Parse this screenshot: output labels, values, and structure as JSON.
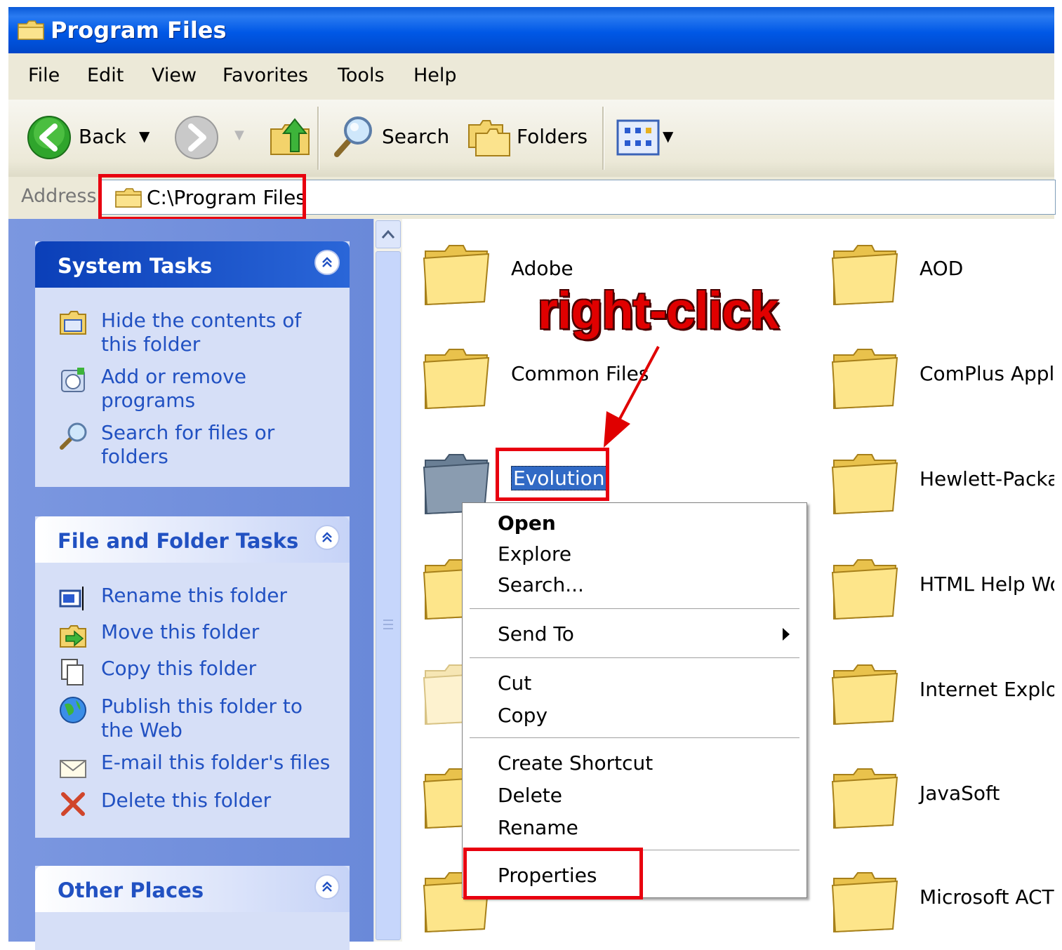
{
  "window": {
    "title": "Program Files",
    "title_icon": "folder-icon"
  },
  "menu": [
    "File",
    "Edit",
    "View",
    "Favorites",
    "Tools",
    "Help"
  ],
  "toolbar": {
    "back_label": "Back",
    "search_label": "Search",
    "folders_label": "Folders"
  },
  "address": {
    "label": "Address",
    "path": "C:\\Program Files"
  },
  "panels": {
    "system_tasks": {
      "title": "System Tasks",
      "links": [
        "Hide the contents of this folder",
        "Add or remove programs",
        "Search for files or folders"
      ]
    },
    "file_folder_tasks": {
      "title": "File and Folder Tasks",
      "links": [
        "Rename this folder",
        "Move this folder",
        "Copy this folder",
        "Publish this folder to the Web",
        "E-mail this folder's files",
        "Delete this folder"
      ]
    },
    "other_places": {
      "title": "Other Places"
    }
  },
  "folders": {
    "adobe": "Adobe",
    "aod": "AOD",
    "common_files": "Common Files",
    "complus": "ComPlus Applic",
    "evolution": "Evolution",
    "hewlett": "Hewlett-Packar",
    "html_help": "HTML Help Wor",
    "internet_explorer": "Internet Explor",
    "javasoft": "JavaSoft",
    "microsoft_act": "Microsoft ACT"
  },
  "annotation": "right-click",
  "context_menu": {
    "open": "Open",
    "explore": "Explore",
    "search": "Search...",
    "send_to": "Send To",
    "cut": "Cut",
    "copy": "Copy",
    "create_shortcut": "Create Shortcut",
    "delete": "Delete",
    "rename": "Rename",
    "properties": "Properties"
  },
  "colors": {
    "titlebar": "#0058e6",
    "highlight_box": "#e8000f",
    "selection": "#316ac5",
    "task_link": "#2151c2"
  }
}
